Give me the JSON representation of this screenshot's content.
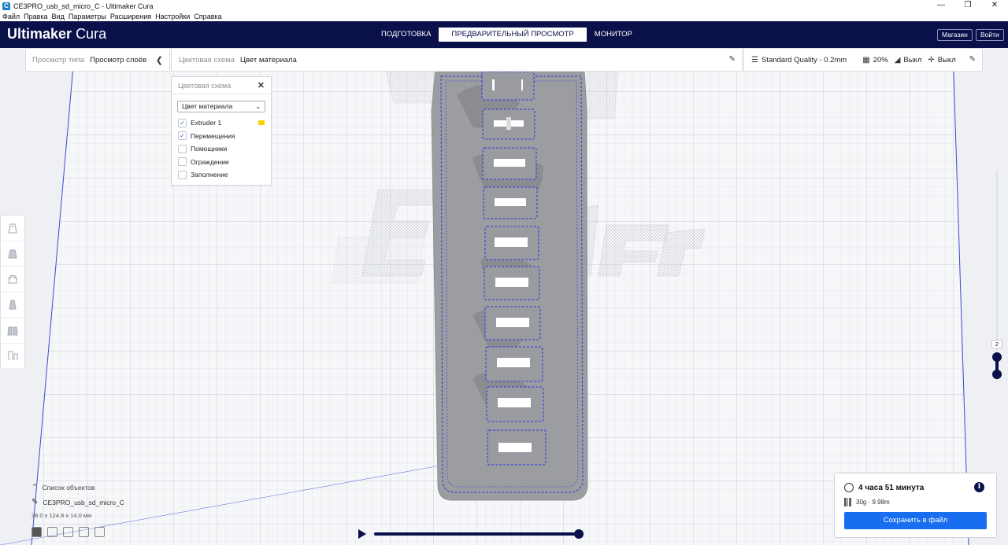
{
  "window": {
    "title": "CE3PRO_usb_sd_micro_C - Ultimaker Cura",
    "minimize": "—",
    "maximize": "❐",
    "close": "✕"
  },
  "menu": [
    "Файл",
    "Правка",
    "Вид",
    "Параметры",
    "Расширения",
    "Настройки",
    "Справка"
  ],
  "header": {
    "logo_bold": "Ultimaker",
    "logo_light": "Cura",
    "stages": [
      {
        "label": "ПОДГОТОВКА",
        "active": false
      },
      {
        "label": "ПРЕДВАРИТЕЛЬНЫЙ ПРОСМОТР",
        "active": true
      },
      {
        "label": "МОНИТОР",
        "active": false
      }
    ],
    "marketplace_label": "Магазин",
    "signin_label": "Войти"
  },
  "view_type": {
    "label": "Просмотр типа",
    "value": "Просмотр слоёв"
  },
  "color_scheme_bar": {
    "label": "Цветовая схема",
    "value": "Цвет материала"
  },
  "print_setup": {
    "profile": "Standard Quality - 0.2mm",
    "infill": "20%",
    "support": "Выкл",
    "adhesion": "Выкл"
  },
  "color_scheme_panel": {
    "title": "Цветовая схема",
    "selected_option": "Цвет материала",
    "items": [
      {
        "label": "Extruder 1",
        "checked": true
      },
      {
        "label": "Перемещения",
        "checked": true
      },
      {
        "label": "Помощники",
        "checked": false
      },
      {
        "label": "Ограждение",
        "checked": false
      },
      {
        "label": "Заполнение",
        "checked": false
      }
    ],
    "extruder_color": "#f5d200"
  },
  "layer_slider": {
    "current_layer": "2"
  },
  "object_list": {
    "toggle_label": "Список объектов",
    "object_name": "CE3PRO_usb_sd_micro_C",
    "dimensions": "38.0 x 124.8 x 14.0 мм"
  },
  "print_info": {
    "time": "4 часа 51 минута",
    "material": "30g · 9.98m",
    "save_label": "Сохранить в файл"
  },
  "colors": {
    "header_bg": "#0a1049",
    "accent_blue": "#196ef0"
  }
}
